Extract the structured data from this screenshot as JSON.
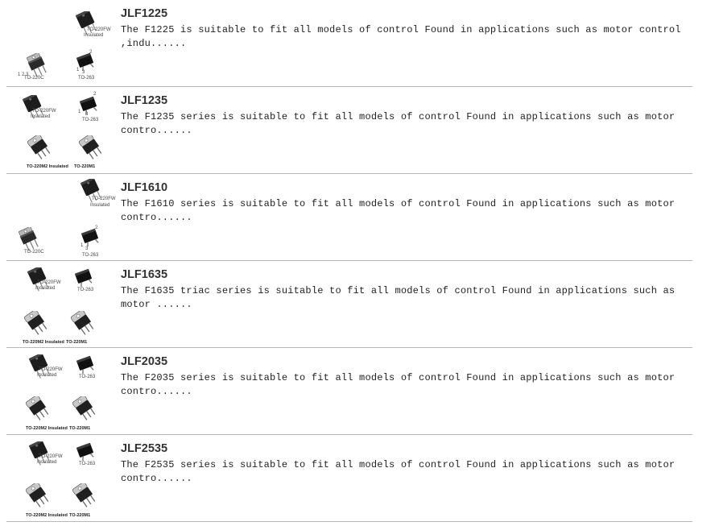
{
  "products": [
    {
      "name": "JLF1225",
      "description": "The F1225 is suitable to fit all models of control Found in applications such as motor control ,indu......",
      "packages": [
        "TO-220FW",
        "Insulated",
        "TO-220C",
        "TO-263",
        "1 2 3",
        "2",
        "1",
        "3"
      ]
    },
    {
      "name": "JLF1235",
      "description": "The F1235 series is suitable to fit all models of control Found in applications such as motor contro......",
      "packages": [
        "TO-220FW",
        "Insulated",
        "TO-263",
        "TO-220M2 Insulated",
        "TO-220M1",
        "2",
        "1",
        "3"
      ]
    },
    {
      "name": "JLF1610",
      "description": "The F1610 series is suitable to fit all models of control Found in applications such as motor contro......",
      "packages": [
        "TO-220FW",
        "Insulated",
        "TO-220C",
        "TO-263",
        "2",
        "1",
        "3"
      ]
    },
    {
      "name": "JLF1635",
      "description": "The F1635 triac series is suitable to fit all models of control Found in applications such as motor ......",
      "packages": [
        "TO-220FW",
        "Insulated",
        "TO-263",
        "TO-220M2 Insulated",
        "TO-220M1"
      ]
    },
    {
      "name": "JLF2035",
      "description": "The F2035 series is suitable to fit all models of control Found in applications such as motor contro......",
      "packages": [
        "TO-220FW",
        "Insulated",
        "TO-263",
        "TO-220M2 Insulated",
        "TO-220M1"
      ]
    },
    {
      "name": "JLF2535",
      "description": "The F2535 series is suitable to fit all models of control Found in applications such as motor contro......",
      "packages": [
        "TO-220FW",
        "Insulated",
        "TO-263",
        "TO-220M2 Insulated",
        "TO-220M1"
      ]
    }
  ]
}
